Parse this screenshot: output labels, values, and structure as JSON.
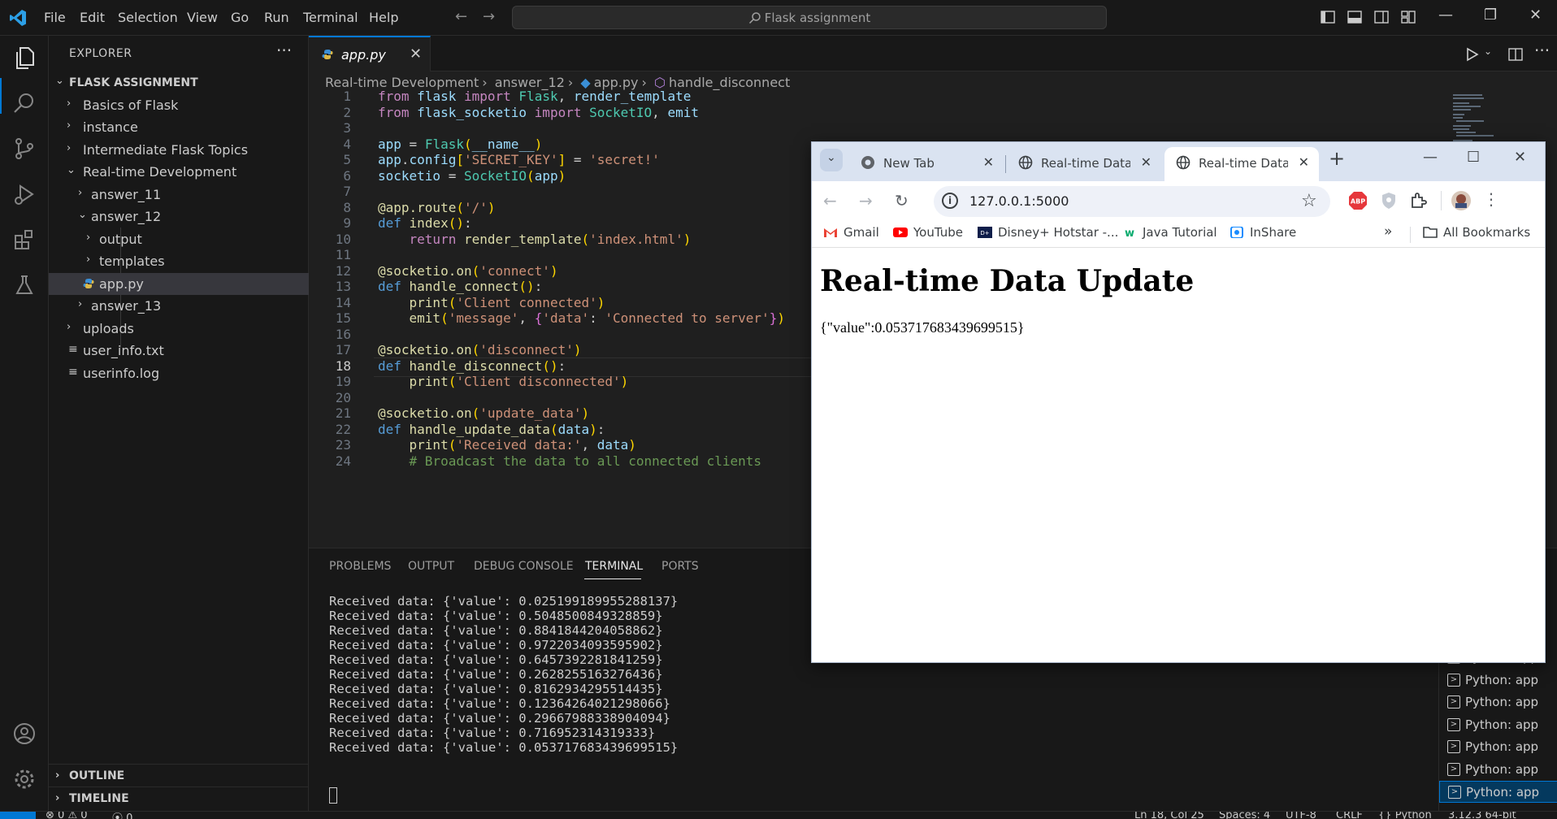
{
  "window": {
    "title": "Flask assignment"
  },
  "menu": [
    "File",
    "Edit",
    "Selection",
    "View",
    "Go",
    "Run",
    "Terminal",
    "Help"
  ],
  "sidebar": {
    "title": "EXPLORER",
    "root": "FLASK ASSIGNMENT",
    "items": [
      {
        "label": "Basics of Flask",
        "kind": "folder",
        "open": false
      },
      {
        "label": "instance",
        "kind": "folder",
        "open": false
      },
      {
        "label": "Intermediate Flask Topics",
        "kind": "folder",
        "open": false
      },
      {
        "label": "Real-time Development",
        "kind": "folder",
        "open": true
      },
      {
        "label": "answer_11",
        "kind": "folder",
        "open": false
      },
      {
        "label": "answer_12",
        "kind": "folder",
        "open": true
      },
      {
        "label": "output",
        "kind": "folder",
        "open": false
      },
      {
        "label": "templates",
        "kind": "folder",
        "open": false
      },
      {
        "label": "app.py",
        "kind": "python",
        "selected": true
      },
      {
        "label": "answer_13",
        "kind": "folder",
        "open": false
      },
      {
        "label": "uploads",
        "kind": "folder",
        "open": false
      },
      {
        "label": "user_info.txt",
        "kind": "text"
      },
      {
        "label": "userinfo.log",
        "kind": "text"
      }
    ],
    "outline": "OUTLINE",
    "timeline": "TIMELINE"
  },
  "editor": {
    "tab_label": "app.py",
    "breadcrumb": [
      "Real-time Development",
      "answer_12",
      "app.py",
      "handle_disconnect"
    ],
    "current_line": 18,
    "lines": [
      "from flask import Flask, render_template",
      "from flask_socketio import SocketIO, emit",
      "",
      "app = Flask(__name__)",
      "app.config['SECRET_KEY'] = 'secret!'",
      "socketio = SocketIO(app)",
      "",
      "@app.route('/')",
      "def index():",
      "    return render_template('index.html')",
      "",
      "@socketio.on('connect')",
      "def handle_connect():",
      "    print('Client connected')",
      "    emit('message', {'data': 'Connected to server'})",
      "",
      "@socketio.on('disconnect')",
      "def handle_disconnect():",
      "    print('Client disconnected')",
      "",
      "@socketio.on('update_data')",
      "def handle_update_data(data):",
      "    print('Received data:', data)",
      "    # Broadcast the data to all connected clients"
    ]
  },
  "panel": {
    "tabs": [
      "PROBLEMS",
      "OUTPUT",
      "DEBUG CONSOLE",
      "TERMINAL",
      "PORTS"
    ],
    "active_tab": "TERMINAL",
    "terminal_lines": [
      "Received data: {'value': 0.025199189955288137}",
      "Received data: {'value': 0.5048500849328859}",
      "Received data: {'value': 0.8841844204058862}",
      "Received data: {'value': 0.9722034093595902}",
      "Received data: {'value': 0.6457392281841259}",
      "Received data: {'value': 0.2628255163276436}",
      "Received data: {'value': 0.8162934295514435}",
      "Received data: {'value': 0.12364264021298066}",
      "Received data: {'value': 0.29667988338904094}",
      "Received data: {'value': 0.716952314319333}",
      "Received data: {'value': 0.053717683439699515}"
    ],
    "terminal_list": [
      "Python: app",
      "Python: app",
      "Python: app",
      "Python: app",
      "Python: app",
      "Python: app",
      "Python: app"
    ]
  },
  "statusbar": {
    "errors": "0",
    "warnings": "0",
    "ports": "0",
    "position": "Ln 18, Col 25",
    "spaces": "Spaces: 4",
    "encoding": "UTF-8",
    "eol": "CRLF",
    "language": "Python",
    "interpreter": "3.12.3 64-bit"
  },
  "browser": {
    "tabs": [
      "New Tab",
      "Real-time Data",
      "Real-time Data"
    ],
    "active_tab_index": 2,
    "url": "127.0.0.1:5000",
    "bookmarks": [
      "Gmail",
      "YouTube",
      "Disney+ Hotstar -...",
      "Java Tutorial",
      "InShare"
    ],
    "all_bookmarks": "All Bookmarks",
    "page": {
      "heading": "Real-time Data Update",
      "data_text": "{\"value\":0.053717683439699515}"
    },
    "colors": {
      "tabstrip": "#dae3f1",
      "youtube": "#ff0000",
      "abp": "#e6373b"
    }
  }
}
